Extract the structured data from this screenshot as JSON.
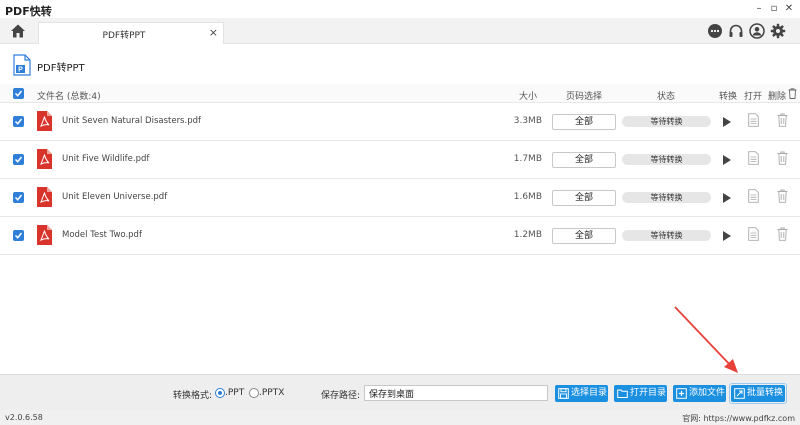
{
  "app": {
    "title": "PDF快转"
  },
  "window_controls": {
    "minimize": "–",
    "maximize": "▫",
    "close": "✕"
  },
  "tab": {
    "title": "PDF转PPT",
    "close": "×"
  },
  "toolbar_icons": [
    "home-icon",
    "chat-icon",
    "headset-icon",
    "user-icon",
    "gear-icon"
  ],
  "header": {
    "title": "PDF转PPT",
    "icon": "ppt-file-icon"
  },
  "columns": {
    "filename": "文件名 (总数:4)",
    "size": "大小",
    "range": "页码选择",
    "status": "状态",
    "convert": "转换",
    "open": "打开",
    "delete": "删除"
  },
  "files": [
    {
      "name": "Unit Seven Natural Disasters.pdf",
      "size": "3.3MB",
      "range": "全部",
      "status": "等待转换",
      "checked": true
    },
    {
      "name": "Unit Five Wildlife.pdf",
      "size": "1.7MB",
      "range": "全部",
      "status": "等待转换",
      "checked": true
    },
    {
      "name": "Unit Eleven Universe.pdf",
      "size": "1.6MB",
      "range": "全部",
      "status": "等待转换",
      "checked": true
    },
    {
      "name": "Model Test Two.pdf",
      "size": "1.2MB",
      "range": "全部",
      "status": "等待转换",
      "checked": true
    }
  ],
  "bottom": {
    "format_label": "转换格式:",
    "format_ppt": ".PPT",
    "format_pptx": ".PPTX",
    "selected_format": ".PPT",
    "path_label": "保存路径:",
    "path_value": "保存到桌面",
    "select_dir": "选择目录",
    "open_dir": "打开目录",
    "add_file": "添加文件",
    "batch_convert": "批量转换"
  },
  "statusbar": {
    "version": "v2.0.6.58",
    "website": "官网:  https://www.pdfkz.com"
  },
  "colors": {
    "accent": "#1b8fe0",
    "checkbox": "#2f7fd9",
    "pdf_red": "#d9342b",
    "arrow": "#e8413a"
  }
}
